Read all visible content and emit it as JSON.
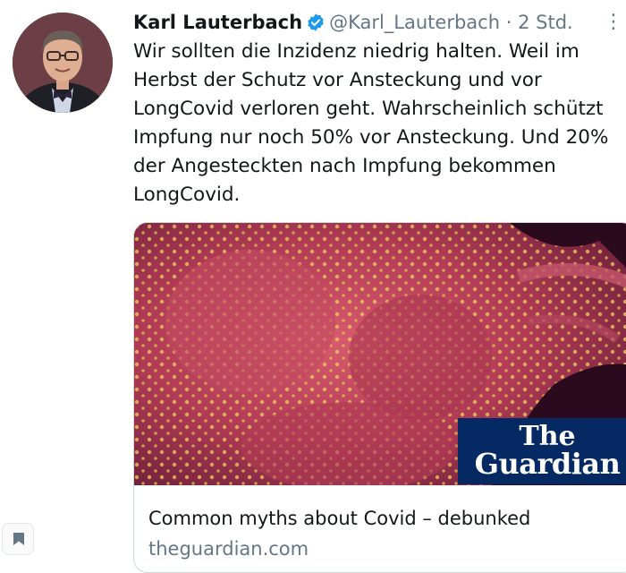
{
  "tweet": {
    "author_name": "Karl Lauterbach",
    "author_handle": "@Karl_Lauterbach",
    "separator": "·",
    "timestamp": "2 Std.",
    "verified": true,
    "text": "Wir sollten die Inzidenz niedrig halten. Weil im\nHerbst der Schutz vor Ansteckung und vor\nLongCovid verloren geht.  Wahrscheinlich schützt\nImpfung nur noch 50% vor Ansteckung. Und 20%\nder Angesteckten nach Impfung bekommen\nLongCovid."
  },
  "card": {
    "logo_line1": "The",
    "logo_line2": "Guardian",
    "title": "Common myths about Covid – debunked",
    "domain": "theguardian.com"
  },
  "icons": {
    "verified": "verified-badge-icon",
    "more": "more-options-icon",
    "bookmark": "bookmark-icon"
  },
  "colors": {
    "verified_blue": "#1d9bf0",
    "secondary_text": "#657786",
    "guardian_blue": "#052962"
  }
}
